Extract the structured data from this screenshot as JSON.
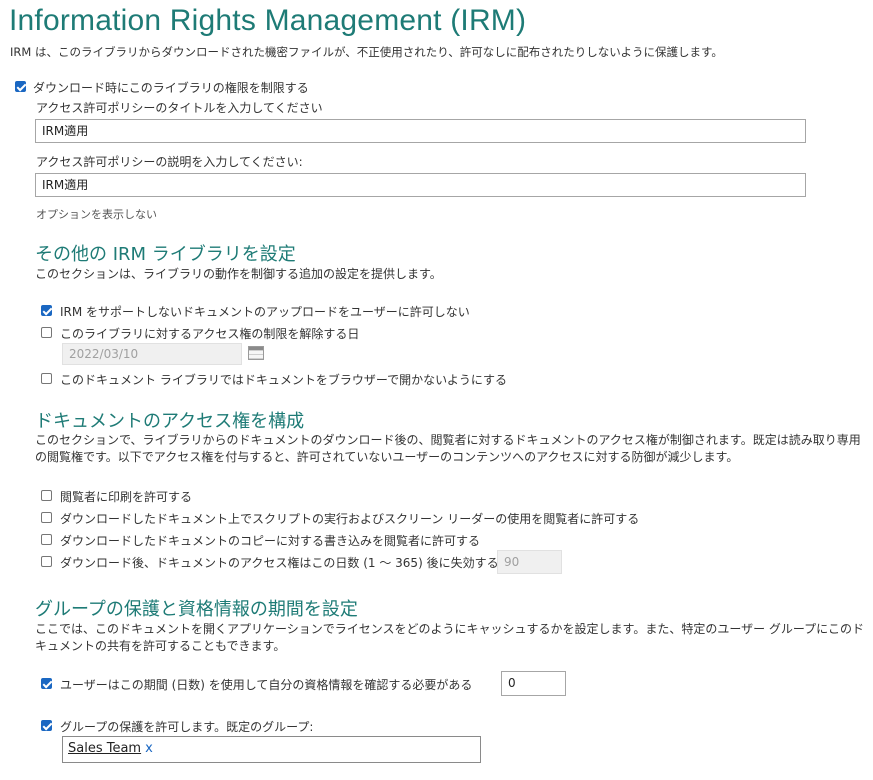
{
  "page_title": "Information Rights Management (IRM)",
  "intro": "IRM は、このライブラリからダウンロードされた機密ファイルが、不正使用されたり、許可なしに配布されたりしないように保護します。",
  "restrict": {
    "checkbox_label": "ダウンロード時にこのライブラリの権限を制限する",
    "checked": true,
    "policy_title_label": "アクセス許可ポリシーのタイトルを入力してください",
    "policy_title_value": "IRM適用",
    "policy_desc_label": "アクセス許可ポリシーの説明を入力してください:",
    "policy_desc_value": "IRM適用",
    "hide_options_link": "オプションを表示しない"
  },
  "library_section": {
    "heading": "その他の IRM ライブラリを設定",
    "description": "このセクションは、ライブラリの動作を制御する追加の設定を提供します。",
    "options": [
      {
        "label": "IRM をサポートしないドキュメントのアップロードをユーザーに許可しない",
        "checked": true
      },
      {
        "label": "このライブラリに対するアクセス権の制限を解除する日",
        "checked": false
      },
      {
        "label": "このドキュメント ライブラリではドキュメントをブラウザーで開かないようにする",
        "checked": false
      }
    ],
    "date_value": "2022/03/10"
  },
  "access_section": {
    "heading": "ドキュメントのアクセス権を構成",
    "description": "このセクションで、ライブラリからのドキュメントのダウンロード後の、閲覧者に対するドキュメントのアクセス権が制御されます。既定は読み取り専用の閲覧権です。以下でアクセス権を付与すると、許可されていないユーザーのコンテンツへのアクセスに対する防御が減少します。",
    "options": [
      {
        "label": "閲覧者に印刷を許可する",
        "checked": false
      },
      {
        "label": "ダウンロードしたドキュメント上でスクリプトの実行およびスクリーン リーダーの使用を閲覧者に許可する",
        "checked": false
      },
      {
        "label": "ダウンロードしたドキュメントのコピーに対する書き込みを閲覧者に許可する",
        "checked": false
      },
      {
        "label": "ダウンロード後、ドキュメントのアクセス権はこの日数 (1 ～ 365) 後に失効する",
        "checked": false
      }
    ],
    "expire_days_value": "90"
  },
  "group_section": {
    "heading": "グループの保護と資格情報の期間を設定",
    "description": "ここでは、このドキュメントを開くアプリケーションでライセンスをどのようにキャッシュするかを設定します。また、特定のユーザー グループにこのドキュメントの共有を許可することもできます。",
    "verify_label": "ユーザーはこの期間 (日数) を使用して自分の資格情報を確認する必要がある",
    "verify_checked": true,
    "verify_days_value": "0",
    "group_label": "グループの保護を許可します。既定のグループ:",
    "group_checked": true,
    "group_token": "Sales Team",
    "group_token_remove": "x"
  },
  "colors": {
    "heading": "#1e7b76",
    "checkbox_checked": "#1a67c2"
  }
}
